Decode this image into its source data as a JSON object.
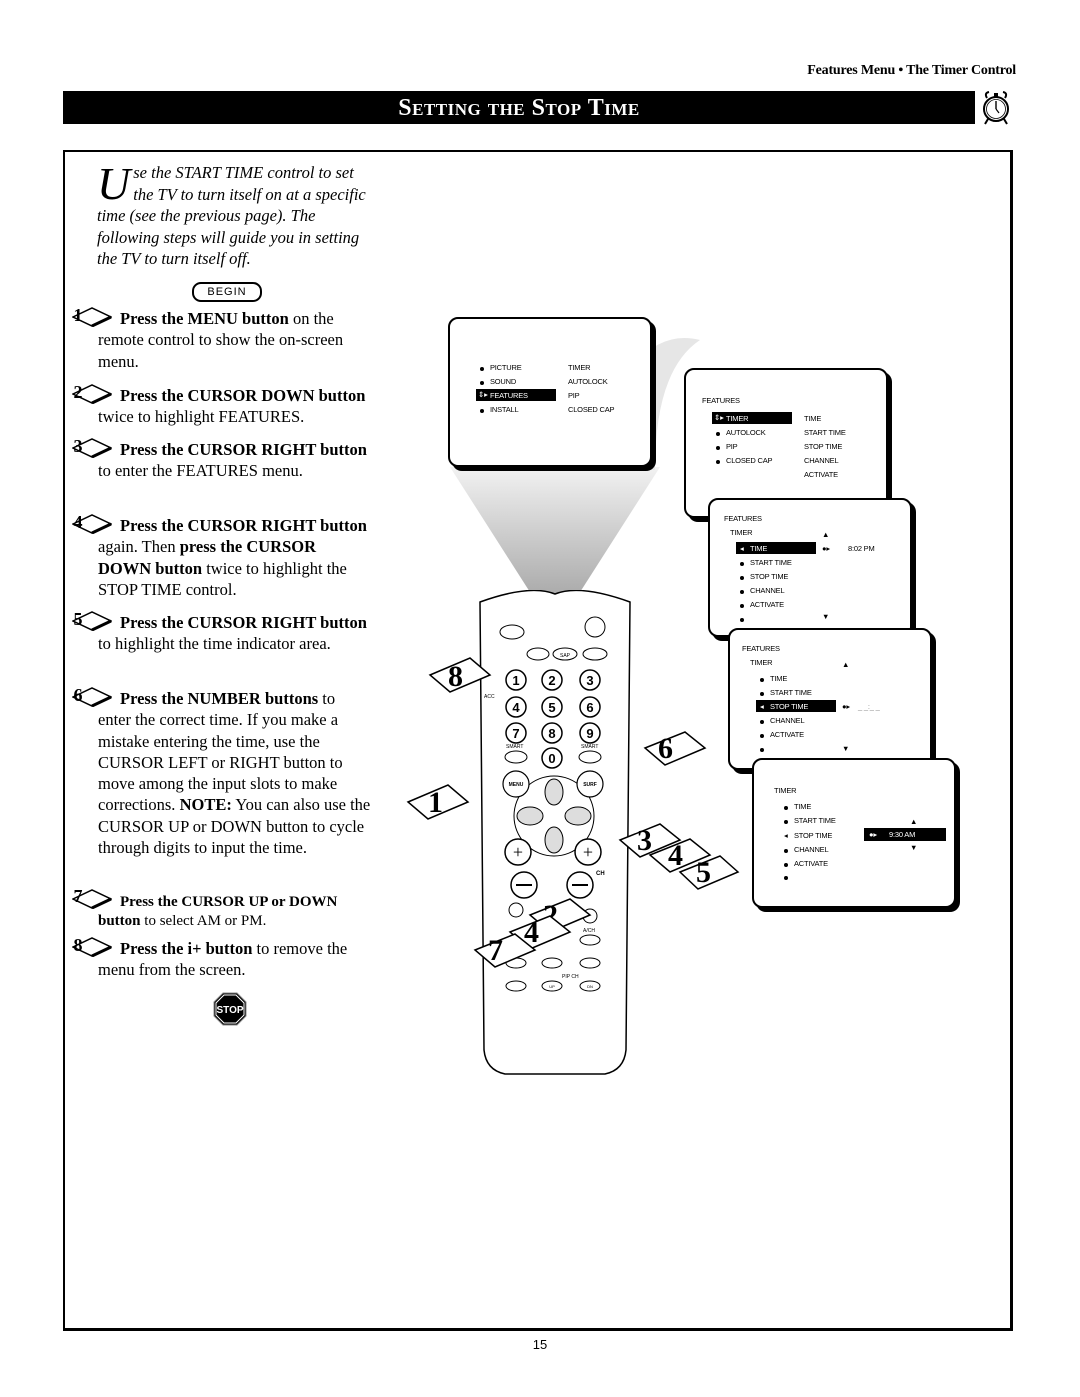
{
  "running_head": "Features Menu • The Timer Control",
  "title": "Setting the Stop Time",
  "intro": {
    "drop_cap": "U",
    "text": "se the START TIME control to set the TV to turn itself on at a specific time (see the previous page). The following steps will guide you in setting the TV to turn itself off."
  },
  "begin_label": "BEGIN",
  "steps": [
    {
      "num": "1",
      "bold": "Press the MENU button",
      "rest": " on the remote control to show the on-screen menu."
    },
    {
      "num": "2",
      "bold": "Press the CURSOR DOWN button",
      "rest": " twice to highlight FEATURES."
    },
    {
      "num": "3",
      "bold": "Press the CURSOR RIGHT button",
      "rest": " to enter the FEATURES menu."
    },
    {
      "num": "4",
      "bold": "Press the CURSOR RIGHT button",
      "rest": " again. Then ",
      "bold2": "press the CURSOR DOWN button",
      "rest2": " twice to highlight the STOP TIME control."
    },
    {
      "num": "5",
      "bold": "Press the CURSOR RIGHT button",
      "rest": " to highlight the time indicator area."
    },
    {
      "num": "6",
      "bold": "Press the NUMBER buttons",
      "rest": " to enter the correct time. If you make a mistake entering the time, use the CURSOR LEFT or RIGHT button to move among the input slots to make corrections. ",
      "bold2": "NOTE:",
      "rest2": " You can also use the CURSOR UP or DOWN button to cycle through digits to input the time."
    },
    {
      "num": "7",
      "bold": "Press the CURSOR UP or DOWN button",
      "rest": " to select AM or PM."
    },
    {
      "num": "8",
      "bold": "Press the i+ button",
      "rest": " to remove the menu from the screen."
    }
  ],
  "stop_label": "STOP",
  "screens": {
    "main_menu": {
      "left": [
        "PICTURE",
        "SOUND",
        "FEATURES",
        "INSTALL"
      ],
      "right": [
        "TIMER",
        "AUTOLOCK",
        "PIP",
        "CLOSED CAP"
      ],
      "selected": "FEATURES"
    },
    "features_menu": {
      "header": "FEATURES",
      "left": [
        "TIMER",
        "AUTOLOCK",
        "PIP",
        "CLOSED CAP"
      ],
      "right": [
        "TIME",
        "START TIME",
        "STOP TIME",
        "CHANNEL",
        "ACTIVATE"
      ],
      "selected": "TIMER"
    },
    "timer_menu": {
      "header": "FEATURES",
      "sub": "TIMER",
      "items": [
        "TIME",
        "START TIME",
        "STOP TIME",
        "CHANNEL",
        "ACTIVATE"
      ],
      "selected": "TIME",
      "value": "8:02  PM"
    },
    "stop_time_menu": {
      "header": "FEATURES",
      "sub": "TIMER",
      "items": [
        "TIME",
        "START TIME",
        "STOP TIME",
        "CHANNEL",
        "ACTIVATE"
      ],
      "selected": "STOP TIME",
      "value": "_ _:_ _"
    },
    "stop_time_set": {
      "sub": "TIMER",
      "items": [
        "TIME",
        "START TIME",
        "STOP TIME",
        "CHANNEL",
        "ACTIVATE"
      ],
      "selected": "STOP TIME",
      "value": "9:30  AM"
    }
  },
  "remote": {
    "number_keys": [
      "1",
      "2",
      "3",
      "4",
      "5",
      "6",
      "7",
      "8",
      "9",
      "0"
    ],
    "labels": {
      "sap": "SAP",
      "acc": "ACC",
      "smart_left": "SMART",
      "smart_right": "SMART",
      "menu": "MENU",
      "surf": "SURF",
      "ch": "CH",
      "ach": "A/CH",
      "pip_ch": "PIP CH",
      "up": "UP",
      "dn": "DN",
      "inc": "INC"
    }
  },
  "callouts": [
    "8",
    "6",
    "1",
    "3",
    "4",
    "5",
    "2",
    "4",
    "7"
  ],
  "page_number": "15"
}
